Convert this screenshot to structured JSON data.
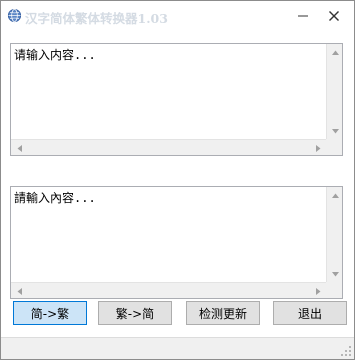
{
  "window": {
    "title": "汉字简体繁体转换器1.03",
    "minimize_symbol": "—",
    "close_symbol": "×"
  },
  "input_box": {
    "text": "请输入内容..."
  },
  "output_box": {
    "text": "請輸入內容..."
  },
  "buttons": {
    "to_traditional": "简->繁",
    "to_simplified": "繁->简",
    "check_update": "检测更新",
    "exit": "退出"
  },
  "colors": {
    "primary_button_bg": "#cce4f7",
    "primary_button_border": "#0078d7",
    "title_text": "#d4dbe3",
    "scrollbar": "#f0f0f0"
  },
  "icons": {
    "app": "globe-icon",
    "minimize": "minimize-icon",
    "close": "close-icon"
  }
}
